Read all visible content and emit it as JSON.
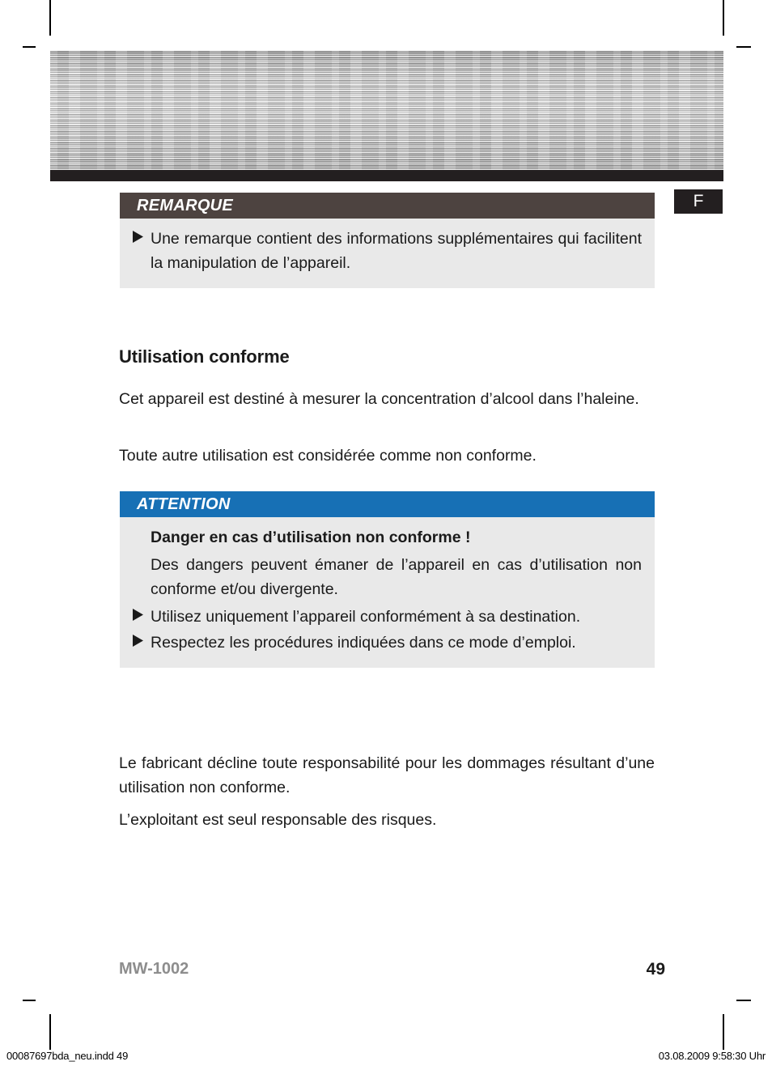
{
  "page": {
    "language_tab": "F",
    "model": "MW-1002",
    "page_number": "49"
  },
  "note_box": {
    "heading": "REMARQUE",
    "bullets": [
      "Une remarque contient des informations supplémentaires qui facilitent la manipulation de l’appareil."
    ]
  },
  "section": {
    "title": "Utilisation conforme",
    "paragraphs": [
      "Cet appareil est destiné à mesurer la concentration d’alcool dans l’haleine.",
      "Toute autre utilisation est considérée comme non conforme."
    ]
  },
  "attention_box": {
    "heading": "ATTENTION",
    "lead": "Danger en cas d’utilisation non conforme !",
    "intro": "Des dangers peuvent émaner de l’appareil en cas d’utilisation non conforme et/ou divergente.",
    "bullets": [
      "Utilisez uniquement l’appareil conformément à sa destination.",
      "Respectez les procédures indiquées dans ce mode d’emploi."
    ]
  },
  "closing": {
    "paragraphs": [
      "Le fabricant décline toute responsabilité pour les dommages résultant d’une utilisation non conforme.",
      "L’exploitant est seul responsable des risques."
    ]
  },
  "print_meta": {
    "left": "00087697bda_neu.indd   49",
    "right": "03.08.2009   9:58:30 Uhr"
  },
  "colors": {
    "note_header": "#4d4340",
    "attention_header": "#1770b5",
    "box_body": "#e9e9e9",
    "lang_tab": "#231f20",
    "model_gray": "#8d8d8d"
  }
}
